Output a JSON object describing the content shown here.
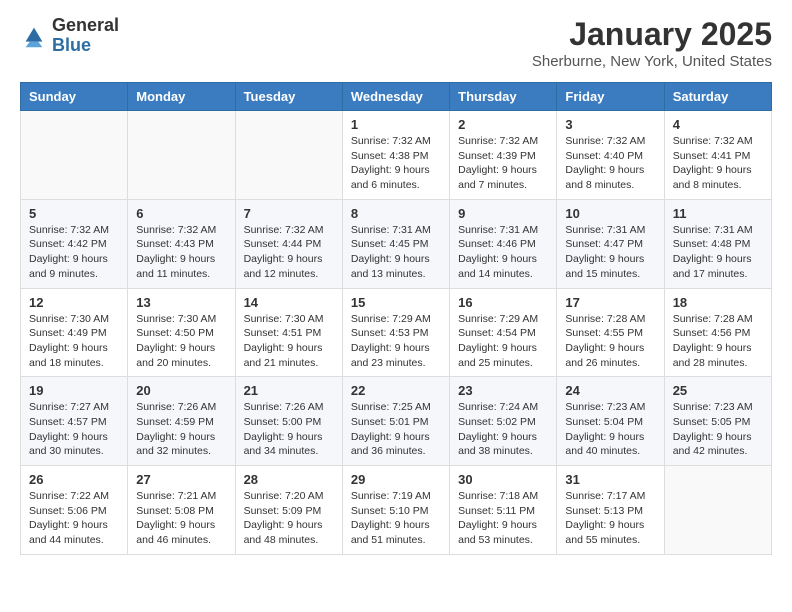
{
  "header": {
    "logo_general": "General",
    "logo_blue": "Blue",
    "title": "January 2025",
    "subtitle": "Sherburne, New York, United States"
  },
  "weekdays": [
    "Sunday",
    "Monday",
    "Tuesday",
    "Wednesday",
    "Thursday",
    "Friday",
    "Saturday"
  ],
  "weeks": [
    [
      {
        "day": "",
        "content": ""
      },
      {
        "day": "",
        "content": ""
      },
      {
        "day": "",
        "content": ""
      },
      {
        "day": "1",
        "content": "Sunrise: 7:32 AM\nSunset: 4:38 PM\nDaylight: 9 hours\nand 6 minutes."
      },
      {
        "day": "2",
        "content": "Sunrise: 7:32 AM\nSunset: 4:39 PM\nDaylight: 9 hours\nand 7 minutes."
      },
      {
        "day": "3",
        "content": "Sunrise: 7:32 AM\nSunset: 4:40 PM\nDaylight: 9 hours\nand 8 minutes."
      },
      {
        "day": "4",
        "content": "Sunrise: 7:32 AM\nSunset: 4:41 PM\nDaylight: 9 hours\nand 8 minutes."
      }
    ],
    [
      {
        "day": "5",
        "content": "Sunrise: 7:32 AM\nSunset: 4:42 PM\nDaylight: 9 hours\nand 9 minutes."
      },
      {
        "day": "6",
        "content": "Sunrise: 7:32 AM\nSunset: 4:43 PM\nDaylight: 9 hours\nand 11 minutes."
      },
      {
        "day": "7",
        "content": "Sunrise: 7:32 AM\nSunset: 4:44 PM\nDaylight: 9 hours\nand 12 minutes."
      },
      {
        "day": "8",
        "content": "Sunrise: 7:31 AM\nSunset: 4:45 PM\nDaylight: 9 hours\nand 13 minutes."
      },
      {
        "day": "9",
        "content": "Sunrise: 7:31 AM\nSunset: 4:46 PM\nDaylight: 9 hours\nand 14 minutes."
      },
      {
        "day": "10",
        "content": "Sunrise: 7:31 AM\nSunset: 4:47 PM\nDaylight: 9 hours\nand 15 minutes."
      },
      {
        "day": "11",
        "content": "Sunrise: 7:31 AM\nSunset: 4:48 PM\nDaylight: 9 hours\nand 17 minutes."
      }
    ],
    [
      {
        "day": "12",
        "content": "Sunrise: 7:30 AM\nSunset: 4:49 PM\nDaylight: 9 hours\nand 18 minutes."
      },
      {
        "day": "13",
        "content": "Sunrise: 7:30 AM\nSunset: 4:50 PM\nDaylight: 9 hours\nand 20 minutes."
      },
      {
        "day": "14",
        "content": "Sunrise: 7:30 AM\nSunset: 4:51 PM\nDaylight: 9 hours\nand 21 minutes."
      },
      {
        "day": "15",
        "content": "Sunrise: 7:29 AM\nSunset: 4:53 PM\nDaylight: 9 hours\nand 23 minutes."
      },
      {
        "day": "16",
        "content": "Sunrise: 7:29 AM\nSunset: 4:54 PM\nDaylight: 9 hours\nand 25 minutes."
      },
      {
        "day": "17",
        "content": "Sunrise: 7:28 AM\nSunset: 4:55 PM\nDaylight: 9 hours\nand 26 minutes."
      },
      {
        "day": "18",
        "content": "Sunrise: 7:28 AM\nSunset: 4:56 PM\nDaylight: 9 hours\nand 28 minutes."
      }
    ],
    [
      {
        "day": "19",
        "content": "Sunrise: 7:27 AM\nSunset: 4:57 PM\nDaylight: 9 hours\nand 30 minutes."
      },
      {
        "day": "20",
        "content": "Sunrise: 7:26 AM\nSunset: 4:59 PM\nDaylight: 9 hours\nand 32 minutes."
      },
      {
        "day": "21",
        "content": "Sunrise: 7:26 AM\nSunset: 5:00 PM\nDaylight: 9 hours\nand 34 minutes."
      },
      {
        "day": "22",
        "content": "Sunrise: 7:25 AM\nSunset: 5:01 PM\nDaylight: 9 hours\nand 36 minutes."
      },
      {
        "day": "23",
        "content": "Sunrise: 7:24 AM\nSunset: 5:02 PM\nDaylight: 9 hours\nand 38 minutes."
      },
      {
        "day": "24",
        "content": "Sunrise: 7:23 AM\nSunset: 5:04 PM\nDaylight: 9 hours\nand 40 minutes."
      },
      {
        "day": "25",
        "content": "Sunrise: 7:23 AM\nSunset: 5:05 PM\nDaylight: 9 hours\nand 42 minutes."
      }
    ],
    [
      {
        "day": "26",
        "content": "Sunrise: 7:22 AM\nSunset: 5:06 PM\nDaylight: 9 hours\nand 44 minutes."
      },
      {
        "day": "27",
        "content": "Sunrise: 7:21 AM\nSunset: 5:08 PM\nDaylight: 9 hours\nand 46 minutes."
      },
      {
        "day": "28",
        "content": "Sunrise: 7:20 AM\nSunset: 5:09 PM\nDaylight: 9 hours\nand 48 minutes."
      },
      {
        "day": "29",
        "content": "Sunrise: 7:19 AM\nSunset: 5:10 PM\nDaylight: 9 hours\nand 51 minutes."
      },
      {
        "day": "30",
        "content": "Sunrise: 7:18 AM\nSunset: 5:11 PM\nDaylight: 9 hours\nand 53 minutes."
      },
      {
        "day": "31",
        "content": "Sunrise: 7:17 AM\nSunset: 5:13 PM\nDaylight: 9 hours\nand 55 minutes."
      },
      {
        "day": "",
        "content": ""
      }
    ]
  ]
}
